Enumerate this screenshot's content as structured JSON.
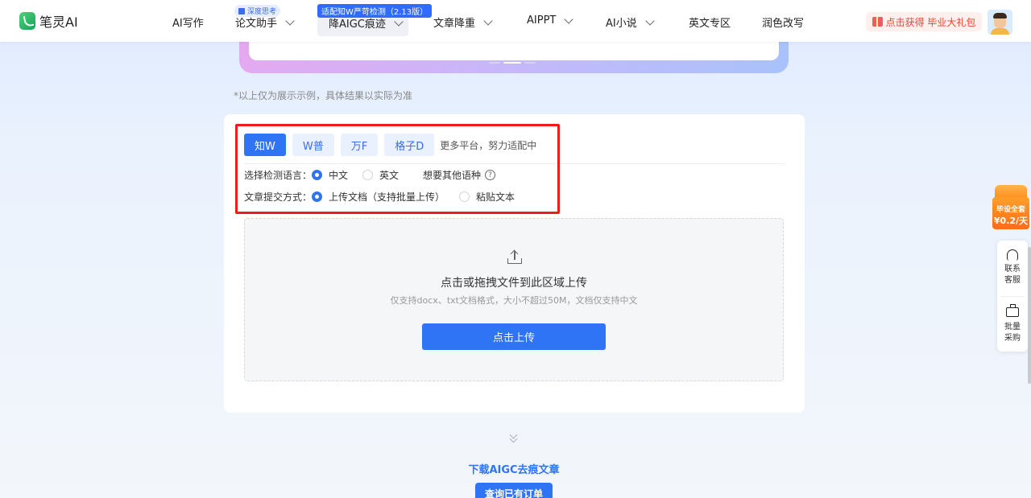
{
  "header": {
    "logo_text": "笔灵AI",
    "nav": [
      {
        "label": "AI写作",
        "has_chevron": false
      },
      {
        "label": "论文助手",
        "has_chevron": true,
        "badge": "深度思考"
      },
      {
        "label": "降AIGC痕迹",
        "has_chevron": true,
        "badge": "适配知W严苛检测（2.13版）",
        "active": true
      },
      {
        "label": "文章降重",
        "has_chevron": true
      },
      {
        "label": "AIPPT",
        "has_chevron": true
      },
      {
        "label": "AI小说",
        "has_chevron": true
      },
      {
        "label": "英文专区",
        "has_chevron": false
      },
      {
        "label": "润色改写",
        "has_chevron": false
      }
    ],
    "gift_label": "点击获得 毕业大礼包"
  },
  "disclaimer": "*以上仅为展示示例，具体结果以实际为准",
  "platform_tabs": {
    "items": [
      "知W",
      "W普",
      "万F",
      "格子D"
    ],
    "active_index": 0,
    "note": "更多平台，努力适配中"
  },
  "language": {
    "label": "选择检测语言：",
    "options": [
      "中文",
      "英文"
    ],
    "selected": "中文",
    "other_label": "想要其他语种",
    "help_icon": "?"
  },
  "submit_mode": {
    "label": "文章提交方式：",
    "options": [
      "上传文档（支持批量上传）",
      "粘贴文本"
    ],
    "selected": "上传文档（支持批量上传）"
  },
  "upload": {
    "title": "点击或拖拽文件到此区域上传",
    "subtitle": "仅支持docx、txt文档格式，大小不超过50M，文档仅支持中文",
    "button": "点击上传"
  },
  "download": {
    "title": "下载AIGC去痕文章",
    "query_button": "查询已有订单"
  },
  "promo": {
    "line1": "毕设全套",
    "line2": "¥0.2/天"
  },
  "side_panel": {
    "contact": "联系客服",
    "bulk": "批量采购"
  },
  "colors": {
    "primary": "#2f74f5",
    "highlight_frame": "#ee1c1c",
    "gift_text": "#e8452b"
  }
}
